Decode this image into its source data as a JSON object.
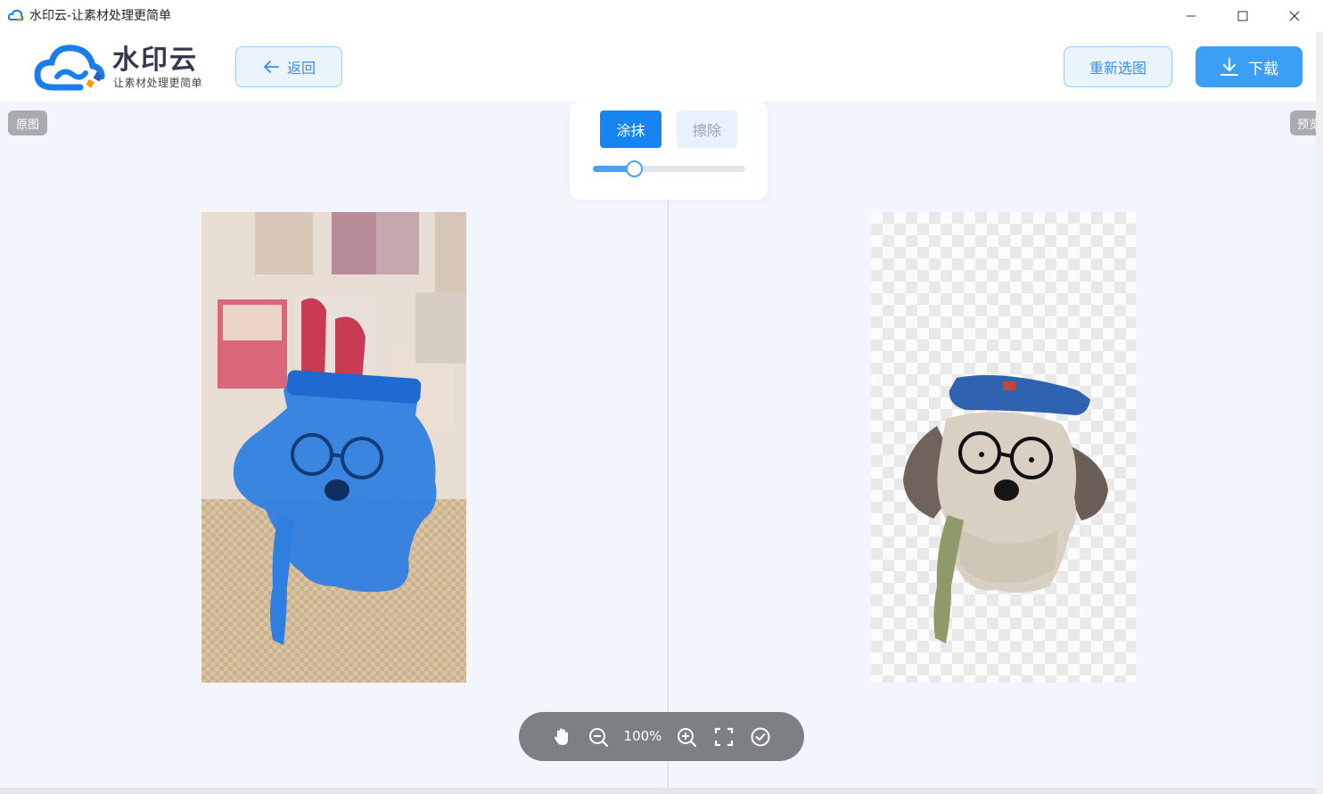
{
  "window": {
    "title": "水印云-让素材处理更简单",
    "app_icon": "cloud-app-icon",
    "controls": [
      "minimize-icon",
      "maximize-icon",
      "close-icon"
    ]
  },
  "header": {
    "logo_title": "水印云",
    "logo_subtitle": "让素材处理更简单",
    "back_label": "返回",
    "reselect_label": "重新选图",
    "download_label": "下载"
  },
  "panels": {
    "original_label": "原图",
    "preview_label": "预览"
  },
  "brush": {
    "smear_label": "涂抹",
    "erase_label": "擦除",
    "active_mode": "涂抹",
    "size_fraction": 0.27
  },
  "toolbar": {
    "zoom_level": "100%",
    "tools": [
      "hand-icon",
      "zoom-out-icon",
      "zoom-in-icon",
      "fullscreen-icon",
      "confirm-icon"
    ]
  },
  "colors": {
    "primary": "#1685f2",
    "download": "#3a9ff5",
    "mask_blue": "#2f7fe0"
  }
}
